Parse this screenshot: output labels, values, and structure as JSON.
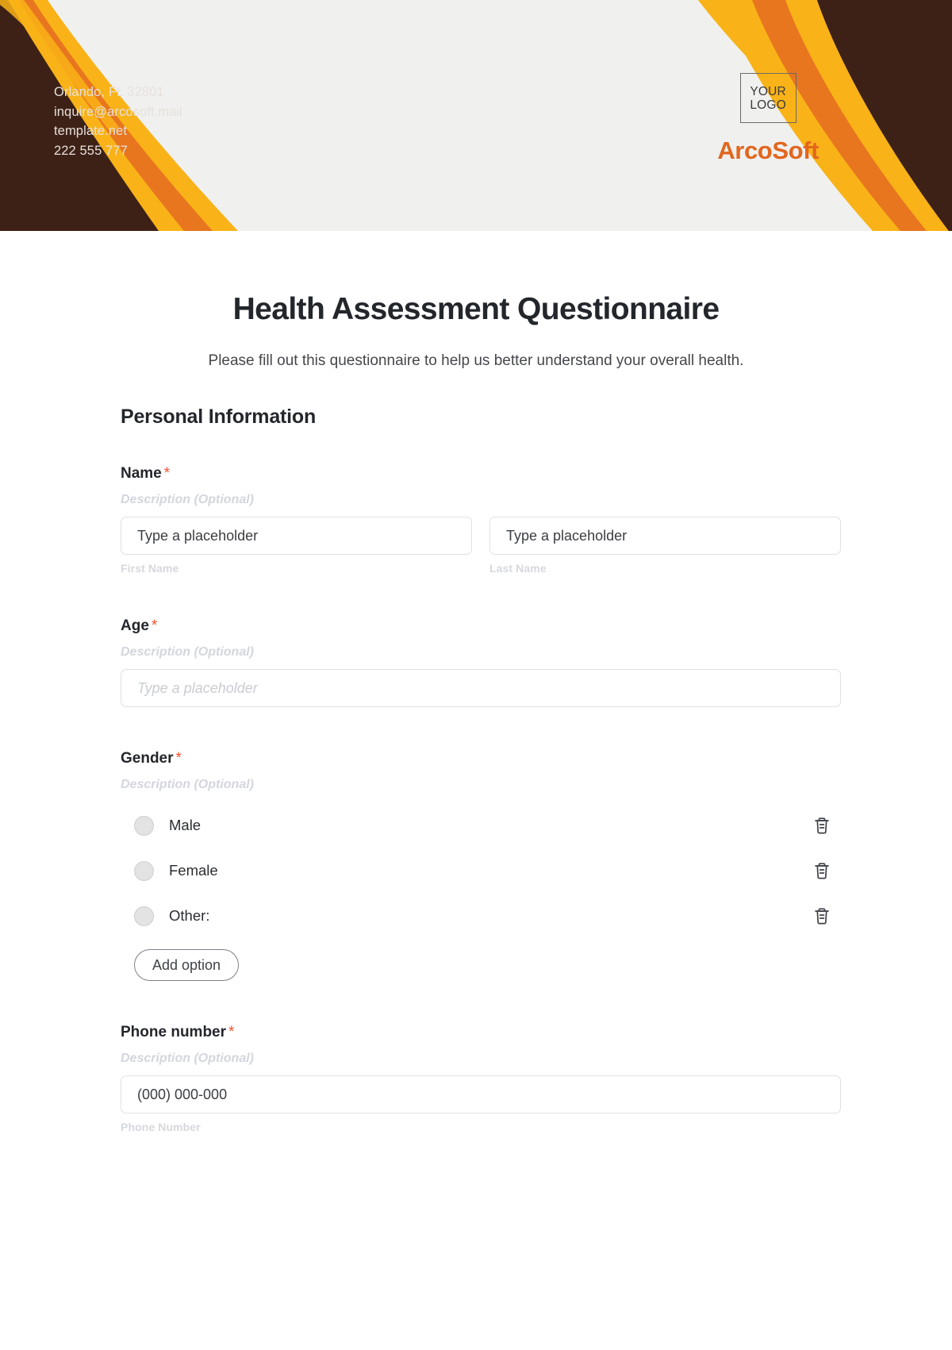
{
  "header": {
    "contact": [
      "Orlando, FL 32801",
      "inquire@arcosoft.mail",
      "template.net",
      "222 555 777"
    ],
    "logo_line1": "YOUR",
    "logo_line2": "LOGO",
    "brand": "ArcoSoft",
    "colors": {
      "dark_brown": "#3e2116",
      "orange": "#e8761e",
      "yellow": "#f9b318",
      "banner_bg": "#f0f0ef",
      "brand_text": "#e2661d"
    }
  },
  "form": {
    "title": "Health Assessment Questionnaire",
    "subtitle": "Please fill out this questionnaire to help us better understand your overall health.",
    "section_heading": "Personal Information",
    "required_marker": "*",
    "description_placeholder": "Description (Optional)",
    "fields": {
      "name": {
        "label": "Name",
        "description": "Description (Optional)",
        "first": {
          "placeholder": "Type a placeholder",
          "sub_label": "First Name"
        },
        "last": {
          "placeholder": "Type a placeholder",
          "sub_label": "Last Name"
        }
      },
      "age": {
        "label": "Age",
        "description": "Description (Optional)",
        "placeholder": "Type a placeholder"
      },
      "gender": {
        "label": "Gender",
        "description": "Description (Optional)",
        "options": [
          {
            "label": "Male",
            "delete_icon": "trash-icon"
          },
          {
            "label": "Female",
            "delete_icon": "trash-icon"
          },
          {
            "label": "Other:",
            "delete_icon": "trash-icon"
          }
        ],
        "add_option_label": "Add option"
      },
      "phone": {
        "label": "Phone number",
        "description": "Description (Optional)",
        "placeholder": "(000) 000-000",
        "sub_label": "Phone Number"
      }
    }
  }
}
